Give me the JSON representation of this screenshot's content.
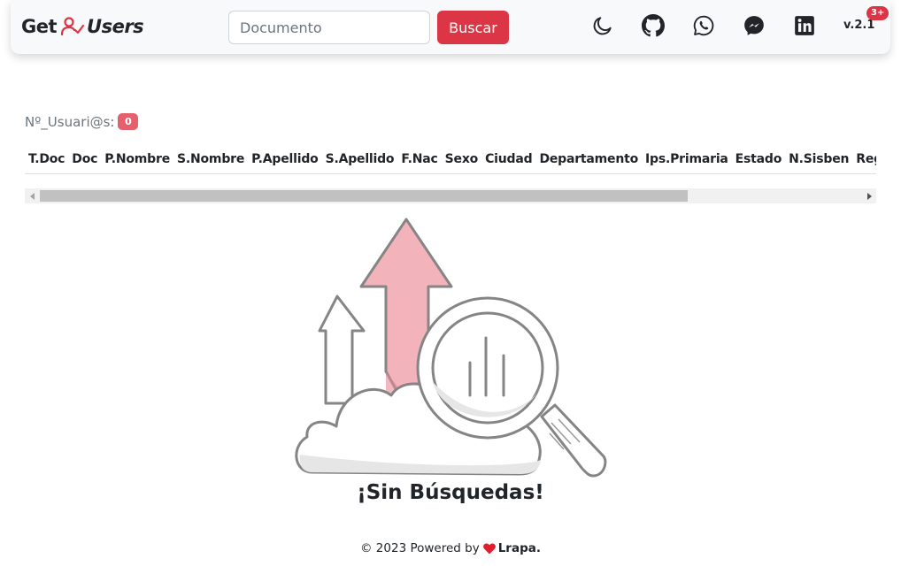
{
  "navbar": {
    "brand_left": "Get",
    "brand_right": "Users",
    "search_placeholder": "Documento",
    "search_button": "Buscar",
    "icons": [
      "moon-icon",
      "github-icon",
      "whatsapp-icon",
      "messenger-icon",
      "linkedin-icon"
    ],
    "version": "v.2.1",
    "version_badge": "3+"
  },
  "results": {
    "count_label": "Nº_Usuari@s:",
    "count_value": "0",
    "columns": [
      "T.Doc",
      "Doc",
      "P.Nombre",
      "S.Nombre",
      "P.Apellido",
      "S.Apellido",
      "F.Nac",
      "Sexo",
      "Ciudad",
      "Departamento",
      "Ips.Primaria",
      "Estado",
      "N.Sisben",
      "Regimen"
    ]
  },
  "empty_state": {
    "title": "¡Sin Búsquedas!"
  },
  "footer": {
    "text": "© 2023 Powered by",
    "author": "Lrapa."
  },
  "colors": {
    "accent": "#dc3545",
    "badge": "#e4606d",
    "navbar_bg": "#f8f9fa",
    "illustration_fill": "#f2b3ba"
  }
}
